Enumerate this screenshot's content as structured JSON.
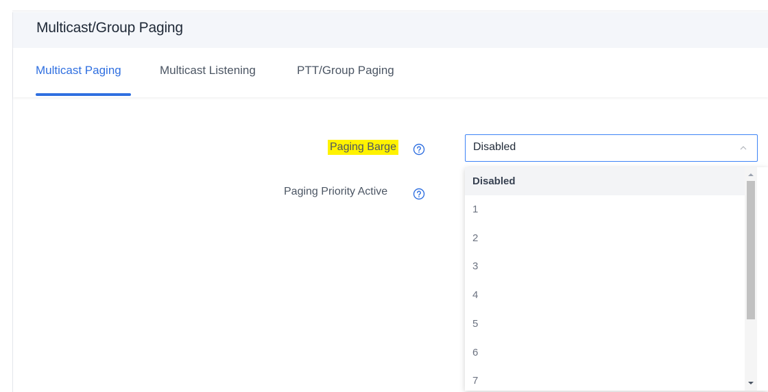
{
  "header": {
    "title": "Multicast/Group Paging"
  },
  "tabs": [
    {
      "label": "Multicast Paging",
      "active": true
    },
    {
      "label": "Multicast Listening",
      "active": false
    },
    {
      "label": "PTT/Group Paging",
      "active": false
    }
  ],
  "form": {
    "paging_barge_label": "Paging Barge",
    "paging_priority_label": "Paging Priority Active"
  },
  "select": {
    "value": "Disabled",
    "options": [
      "Disabled",
      "1",
      "2",
      "3",
      "4",
      "5",
      "6",
      "7"
    ]
  },
  "colors": {
    "accent": "#2f6fe0",
    "highlight": "#fff200",
    "header_bg": "#f4f6fa"
  },
  "icons": {
    "help": "question-circle-icon",
    "caret": "chevron-up-icon"
  }
}
